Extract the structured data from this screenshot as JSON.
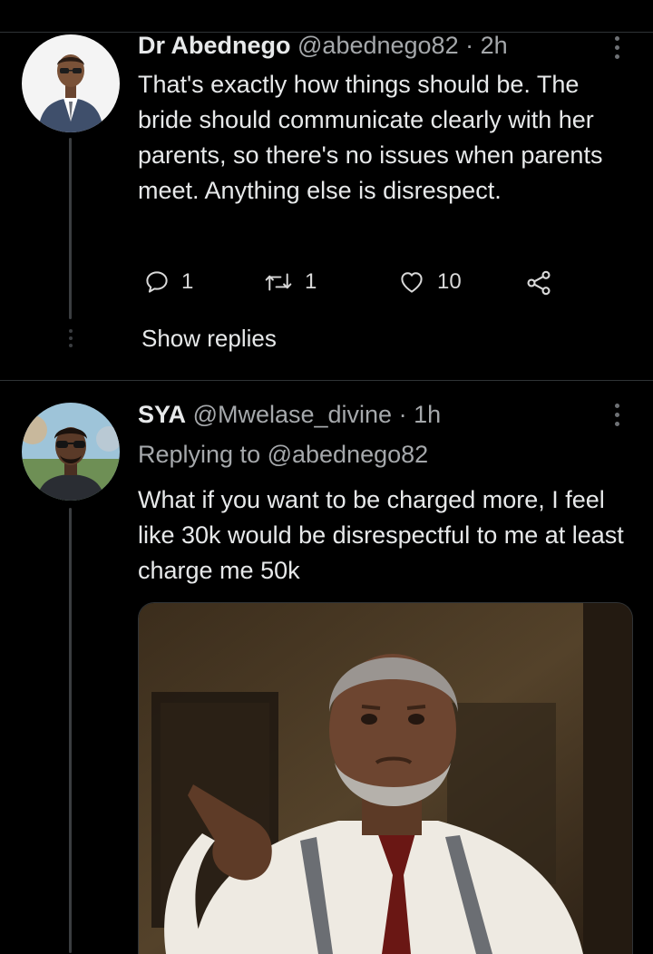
{
  "tweets": [
    {
      "display_name": "Dr Abednego",
      "handle": "@abednego82",
      "separator": "·",
      "time": "2h",
      "text": "That's exactly how things should be. The bride should communicate clearly with her parents, so there's no issues when parents meet. Anything else is disrespect.",
      "actions": {
        "replies": "1",
        "retweets": "1",
        "likes": "10"
      },
      "show_replies_label": "Show replies"
    },
    {
      "display_name": "SYA",
      "handle": "@Mwelase_divine",
      "separator": "·",
      "time": "1h",
      "replying_to_prefix": "Replying to ",
      "replying_to_handle": "@abednego82",
      "text": "What if you want to be charged more, I feel like 30k would be disrespectful to me at least charge me 50k"
    }
  ],
  "icons": {
    "reply": "reply-icon",
    "retweet": "retweet-icon",
    "like": "heart-icon",
    "share": "share-icon",
    "more": "more-vertical-icon"
  },
  "colors": {
    "background": "#000000",
    "text": "#e7e9ea",
    "secondary_text": "#a5a8ab",
    "divider": "#2f3336"
  }
}
